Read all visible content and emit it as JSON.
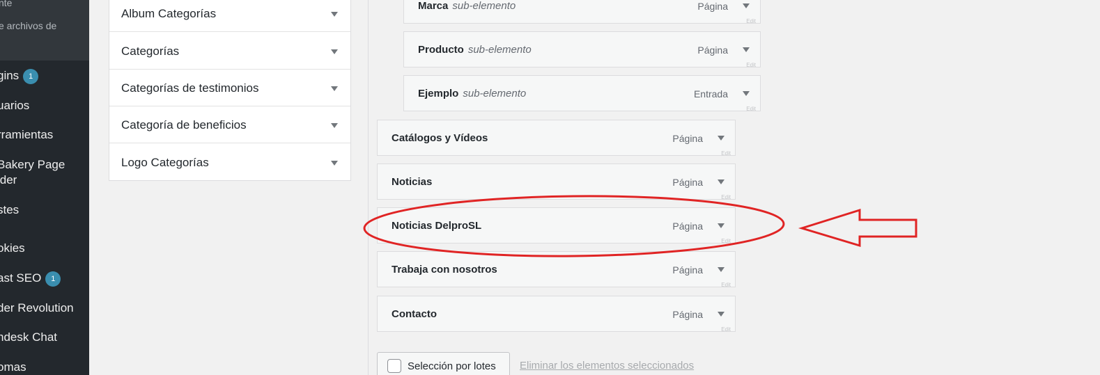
{
  "sidebar": {
    "submenu": [
      {
        "label": "nte"
      },
      {
        "label": "e archivos de"
      }
    ],
    "items": [
      {
        "label": "gins",
        "badge": "1"
      },
      {
        "label": "uarios"
      },
      {
        "label": "rramientas"
      },
      {
        "label": "Bakery Page"
      },
      {
        "label": "lder"
      },
      {
        "label": "stes"
      },
      {
        "label": "okies"
      },
      {
        "label": "ast SEO",
        "badge": "1"
      },
      {
        "label": "der Revolution"
      },
      {
        "label": "ndesk Chat"
      },
      {
        "label": "omas"
      }
    ]
  },
  "accordion": {
    "items": [
      {
        "label": "Album Categorías"
      },
      {
        "label": "Categorías"
      },
      {
        "label": "Categorías de testimonios"
      },
      {
        "label": "Categoría de beneficios"
      },
      {
        "label": "Logo Categorías"
      }
    ]
  },
  "menu": {
    "sub_label": "sub-elemento",
    "edit_label": "Edit",
    "items": [
      {
        "title": "Marca",
        "type": "Página",
        "sub": true
      },
      {
        "title": "Producto",
        "type": "Página",
        "sub": true
      },
      {
        "title": "Ejemplo",
        "type": "Entrada",
        "sub": true
      },
      {
        "title": "Catálogos y Vídeos",
        "type": "Página",
        "sub": false
      },
      {
        "title": "Noticias",
        "type": "Página",
        "sub": false
      },
      {
        "title": "Noticias DelproSL",
        "type": "Página",
        "sub": false,
        "highlighted": true
      },
      {
        "title": "Trabaja con nosotros",
        "type": "Página",
        "sub": false
      },
      {
        "title": "Contacto",
        "type": "Página",
        "sub": false
      }
    ]
  },
  "bulk": {
    "label": "Selección por lotes",
    "remove_label": "Eliminar los elementos seleccionados"
  },
  "colors": {
    "annotation": "#e02424",
    "badge": "#3a8eaf",
    "sidebar_bg": "#23282d"
  }
}
